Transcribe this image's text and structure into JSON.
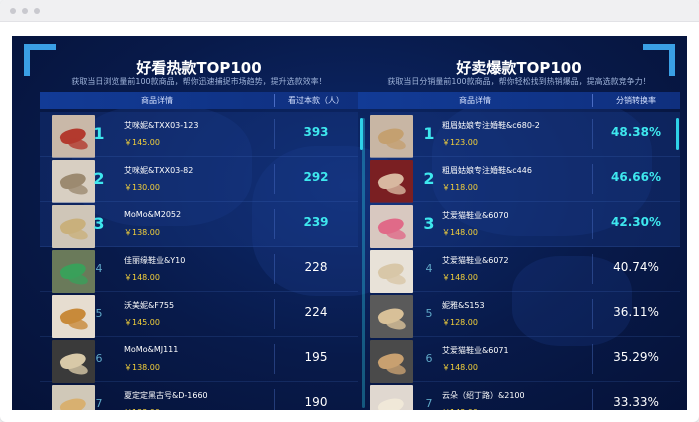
{
  "left_panel": {
    "title": "好看热款TOP100",
    "subtitle": "获取当日浏览量前100款商品，帮你迅速捕捉市场趋势，提升选款效率！",
    "col_product": "商品详情",
    "col_metric": "看过本款（人）",
    "rows": [
      {
        "rank": "1",
        "name": "艾咪妮&TXX03-123",
        "price": "￥145.00",
        "value": "393"
      },
      {
        "rank": "2",
        "name": "艾咪妮&TXX03-82",
        "price": "￥130.00",
        "value": "292"
      },
      {
        "rank": "3",
        "name": "MoMo&M2052",
        "price": "￥138.00",
        "value": "239"
      },
      {
        "rank": "4",
        "name": "佳丽缘鞋业&Y10",
        "price": "￥148.00",
        "value": "228"
      },
      {
        "rank": "5",
        "name": "沃美妮&F755",
        "price": "￥145.00",
        "value": "224"
      },
      {
        "rank": "6",
        "name": "MoMo&MJ111",
        "price": "￥138.00",
        "value": "195"
      },
      {
        "rank": "7",
        "name": "夏定定黑古号&D-1660",
        "price": "￥138.00",
        "value": "190"
      }
    ]
  },
  "right_panel": {
    "title": "好卖爆款TOP100",
    "subtitle": "获取当日分销量前100款商品，帮你轻松找到热销爆品，提高选款竞争力！",
    "col_product": "商品详情",
    "col_metric": "分销转换率",
    "rows": [
      {
        "rank": "1",
        "name": "粗眉姑娘专注婚鞋&c680-2",
        "price": "￥123.00",
        "value": "48.38%"
      },
      {
        "rank": "2",
        "name": "粗眉姑娘专注婚鞋&c446",
        "price": "￥118.00",
        "value": "46.66%"
      },
      {
        "rank": "3",
        "name": "艾爱猫鞋业&6070",
        "price": "￥148.00",
        "value": "42.30%"
      },
      {
        "rank": "4",
        "name": "艾爱猫鞋业&6072",
        "price": "￥148.00",
        "value": "40.74%"
      },
      {
        "rank": "5",
        "name": "妮雅&S153",
        "price": "￥128.00",
        "value": "36.11%"
      },
      {
        "rank": "6",
        "name": "艾爱猫鞋业&6071",
        "price": "￥148.00",
        "value": "35.29%"
      },
      {
        "rank": "7",
        "name": "云朵（绍丁路）&2100",
        "price": "￥148.00",
        "value": "33.33%"
      }
    ]
  },
  "colors": {
    "accent_cyan": "#3ee7ee",
    "price_yellow": "#f5d23a",
    "background_navy": "#081a4a",
    "header_blue": "#123b96"
  }
}
